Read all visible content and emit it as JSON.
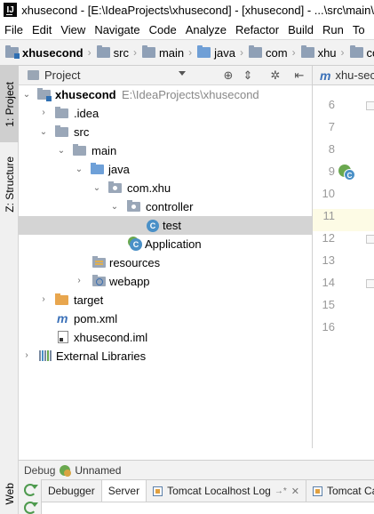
{
  "window": {
    "title": "xhusecond - [E:\\IdeaProjects\\xhusecond] - [xhusecond] - ...\\src\\main\\"
  },
  "menu": [
    "File",
    "Edit",
    "View",
    "Navigate",
    "Code",
    "Analyze",
    "Refactor",
    "Build",
    "Run",
    "To"
  ],
  "breadcrumbs": [
    "xhusecond",
    "src",
    "main",
    "java",
    "com",
    "xhu",
    "com"
  ],
  "left_strip": {
    "project_tab": "1: Project",
    "structure_tab": "Z: Structure",
    "web_tab": "Web"
  },
  "project_panel": {
    "title": "Project",
    "header_icons": [
      "target-icon",
      "collapse-all-icon",
      "gear-icon",
      "hide-icon"
    ],
    "tree": [
      {
        "label": "xhusecond",
        "path": "E:\\IdeaProjects\\xhusecond",
        "expanded": true,
        "icon": "module-folder-icon"
      },
      {
        "label": ".idea",
        "expanded": false,
        "icon": "folder-icon"
      },
      {
        "label": "src",
        "expanded": true,
        "icon": "folder-icon"
      },
      {
        "label": "main",
        "expanded": true,
        "icon": "folder-icon"
      },
      {
        "label": "java",
        "expanded": true,
        "icon": "source-folder-icon"
      },
      {
        "label": "com.xhu",
        "expanded": true,
        "icon": "package-icon"
      },
      {
        "label": "controller",
        "expanded": true,
        "icon": "package-icon"
      },
      {
        "label": "test",
        "icon": "class-icon",
        "selected": true
      },
      {
        "label": "Application",
        "icon": "spring-class-icon"
      },
      {
        "label": "resources",
        "icon": "resources-folder-icon"
      },
      {
        "label": "webapp",
        "expanded": false,
        "icon": "web-folder-icon"
      },
      {
        "label": "target",
        "expanded": false,
        "icon": "excluded-folder-icon"
      },
      {
        "label": "pom.xml",
        "icon": "maven-icon"
      },
      {
        "label": "xhusecond.iml",
        "icon": "iml-file-icon"
      },
      {
        "label": "External Libraries",
        "expanded": false,
        "icon": "libraries-icon"
      }
    ]
  },
  "editor": {
    "tab_label": "xhu-sec",
    "line_numbers": [
      "6",
      "7",
      "8",
      "9",
      "10",
      "11",
      "12",
      "13",
      "14",
      "15",
      "16"
    ],
    "current_line": "11"
  },
  "debug": {
    "label": "Debug",
    "config_name": "Unnamed",
    "tabs": [
      "Debugger",
      "Server",
      "Tomcat Localhost Log",
      "Tomcat Ca"
    ],
    "active_tab": "Server"
  },
  "colors": {
    "selection": "#d4d4d4",
    "current_line": "#fdfbe5",
    "class_icon": "#4a90c7",
    "spring_green": "#6aa84f",
    "excluded_folder": "#e8a64e"
  }
}
